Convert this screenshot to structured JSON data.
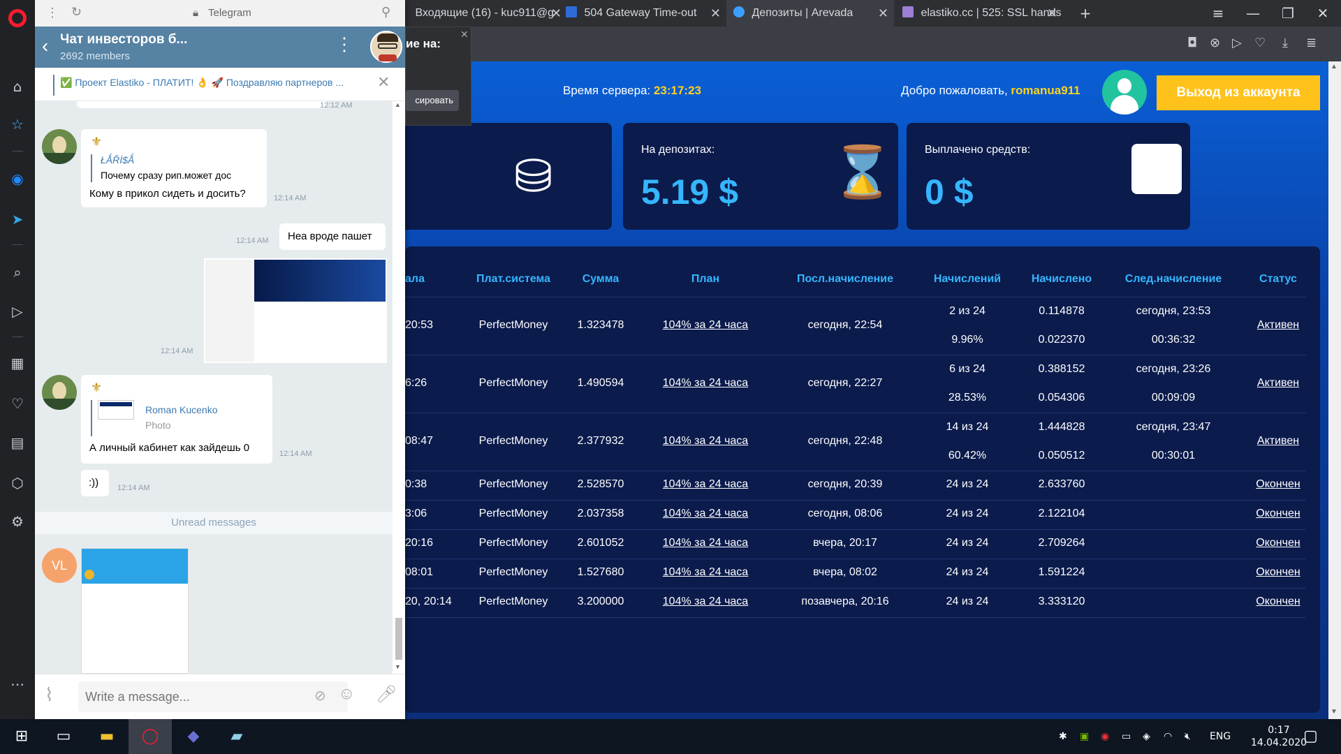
{
  "browser": {
    "tabs": [
      {
        "label": "Входящие (16) - kuc911@g",
        "fav_color": "#d44638"
      },
      {
        "label": "504 Gateway Time-out",
        "fav_color": "#2f6bd8"
      },
      {
        "label": "Депозиты | Arevada",
        "fav_color": "#3aa0ff"
      },
      {
        "label": "elastiko.cc | 525: SSL hands",
        "fav_color": "#9b7fd4"
      }
    ],
    "new_tab": "+"
  },
  "popup": {
    "title_fragment": "ие на:",
    "button_fragment": "сировать"
  },
  "site": {
    "server_time_label": "Время сервера:",
    "server_time": "23:17:23",
    "welcome_label": "Добро пожаловать,",
    "username": "romanua911",
    "logout": "Выход из аккаунта",
    "cards": [
      {
        "label": "",
        "value": ""
      },
      {
        "label": "На депозитах:",
        "value": "5.19 $"
      },
      {
        "label": "Выплачено средств:",
        "value": "0 $"
      }
    ],
    "table": {
      "headers": [
        "ала",
        "Плат.система",
        "Сумма",
        "План",
        "Посл.начисление",
        "Начислений",
        "Начислено",
        "След.начисление",
        "Статус"
      ],
      "rows": [
        {
          "date": "20:53",
          "system": "PerfectMoney",
          "amount": "1.323478",
          "plan": "104% за 24 часа",
          "last": "сегодня, 22:54",
          "count": "2 из 24",
          "pct": "9.96%",
          "earned": "0.114878",
          "earned2": "0.022370",
          "next": "сегодня, 23:53",
          "next2": "00:36:32",
          "status": "Активен"
        },
        {
          "date": "6:26",
          "system": "PerfectMoney",
          "amount": "1.490594",
          "plan": "104% за 24 часа",
          "last": "сегодня, 22:27",
          "count": "6 из 24",
          "pct": "28.53%",
          "earned": "0.388152",
          "earned2": "0.054306",
          "next": "сегодня, 23:26",
          "next2": "00:09:09",
          "status": "Активен"
        },
        {
          "date": "08:47",
          "system": "PerfectMoney",
          "amount": "2.377932",
          "plan": "104% за 24 часа",
          "last": "сегодня, 22:48",
          "count": "14 из 24",
          "pct": "60.42%",
          "earned": "1.444828",
          "earned2": "0.050512",
          "next": "сегодня, 23:47",
          "next2": "00:30:01",
          "status": "Активен"
        },
        {
          "date": "0:38",
          "system": "PerfectMoney",
          "amount": "2.528570",
          "plan": "104% за 24 часа",
          "last": "сегодня, 20:39",
          "count": "24 из 24",
          "earned": "2.633760",
          "status": "Окончен"
        },
        {
          "date": "3:06",
          "system": "PerfectMoney",
          "amount": "2.037358",
          "plan": "104% за 24 часа",
          "last": "сегодня, 08:06",
          "count": "24 из 24",
          "earned": "2.122104",
          "status": "Окончен"
        },
        {
          "date": "20:16",
          "system": "PerfectMoney",
          "amount": "2.601052",
          "plan": "104% за 24 часа",
          "last": "вчера, 20:17",
          "count": "24 из 24",
          "earned": "2.709264",
          "status": "Окончен"
        },
        {
          "date": "08:01",
          "system": "PerfectMoney",
          "amount": "1.527680",
          "plan": "104% за 24 часа",
          "last": "вчера, 08:02",
          "count": "24 из 24",
          "earned": "1.591224",
          "status": "Окончен"
        },
        {
          "date": "20, 20:14",
          "system": "PerfectMoney",
          "amount": "3.200000",
          "plan": "104% за 24 часа",
          "last": "позавчера, 20:16",
          "count": "24 из 24",
          "earned": "3.333120",
          "status": "Окончен"
        }
      ]
    }
  },
  "telegram": {
    "window_title": "Telegram",
    "chat_title": "Чат инвесторов б...",
    "members": "2692 members",
    "pinned": "✅ Проект Elastiko - ПЛАТИТ! 👌 🚀 Поздравляю партнеров ...",
    "messages": {
      "m1_author": "ŁǺŘİ$Ǻ",
      "m1_quote": "Почему сразу рип.может дос",
      "m1_text": "Кому в прикол сидеть и досить?",
      "m1_time": "12:14 AM",
      "m2_text": "Неа вроде пашет",
      "m2_time": "12:14 AM",
      "m3_time": "12:14 AM",
      "m4_reply_author": "Roman Kucenko",
      "m4_reply_kind": "Photo",
      "m4_text": "А личный кабинет как зайдешь 0",
      "m4_time": "12:14 AM",
      "m5_text": ":))",
      "m5_time": "12:14 AM",
      "unread": "Unread messages",
      "vl_initials": "VL",
      "prev_time": "12:12 AM"
    },
    "input_placeholder": "Write a message..."
  },
  "taskbar": {
    "lang": "ENG",
    "time": "0:17",
    "date": "14.04.2020"
  }
}
